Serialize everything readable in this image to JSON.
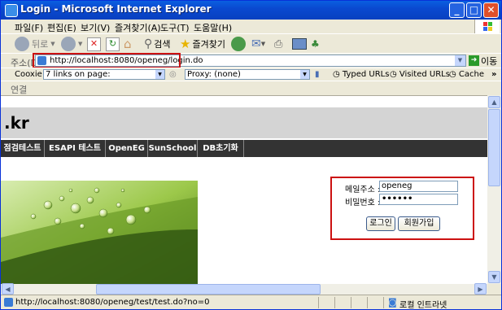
{
  "window": {
    "title": "Login - Microsoft Internet Explorer"
  },
  "menu": [
    "파일(F)",
    "편집(E)",
    "보기(V)",
    "즐겨찾기(A)",
    "도구(T)",
    "도움말(H)"
  ],
  "toolbar": {
    "back": "뒤로",
    "search": "검색",
    "favorites": "즐겨찾기"
  },
  "address": {
    "label": "주소(D)",
    "url": "http://localhost:8080/openeg/login.do",
    "go": "이동"
  },
  "links_bar": {
    "cookie": "Cooxie",
    "links_select": "7 links on page:",
    "proxy_select": "Proxy: (none)",
    "typed": "Typed URLs",
    "visited": "Visited URLs",
    "cache": "Cache"
  },
  "connection": {
    "label": "연결"
  },
  "page": {
    "site_title": ".kr",
    "nav": [
      "점검테스트",
      "ESAPI 테스트",
      "OpenEG",
      "SunSchool",
      "DB초기화"
    ],
    "login": {
      "email_label": "메일주소 :",
      "email_value": "openeg",
      "password_label": "비밀번호 :",
      "password_value": "••••••",
      "login_button": "로그인",
      "register_button": "회원가입"
    }
  },
  "status": {
    "url": "http://localhost:8080/openeg/test/test.do?no=0",
    "zone": "로컬 인트라넷"
  },
  "colors": {
    "title_bar": "#0a49d0",
    "highlight": "#cc1111",
    "nav_bg": "#333333",
    "banner": "#d4d4d4"
  }
}
